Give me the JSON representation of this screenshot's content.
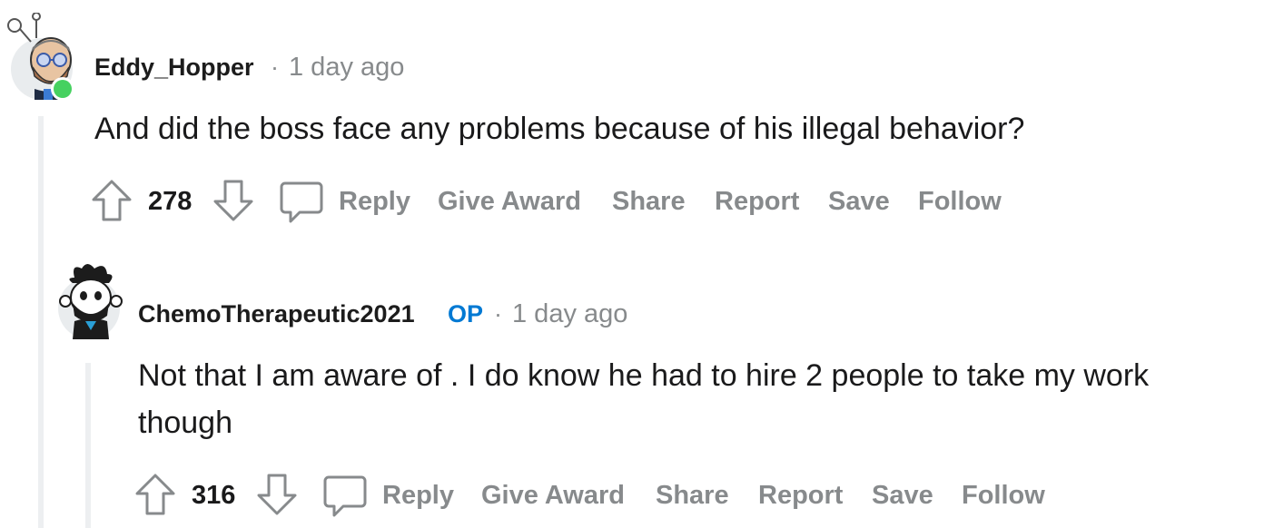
{
  "comments": [
    {
      "username": "Eddy_Hopper",
      "is_op": false,
      "separator": "·",
      "time": "1 day ago",
      "body": "And did the boss face any problems because of his illegal behavior?",
      "score": "278",
      "actions": [
        "Reply",
        "Give Award",
        "Share",
        "Report",
        "Save",
        "Follow"
      ],
      "online": true
    },
    {
      "username": "ChemoTherapeutic2021",
      "is_op": true,
      "op_label": "OP",
      "separator": "·",
      "time": "1 day ago",
      "body": "Not that I am aware of . I do know he had to hire 2 people to take my work though",
      "score": "316",
      "actions": [
        "Reply",
        "Give Award",
        "Share",
        "Report",
        "Save",
        "Follow"
      ]
    }
  ],
  "colors": {
    "text": "#1a1a1b",
    "meta": "#878a8c",
    "op": "#0079d3",
    "thread_line": "#edeff1",
    "online": "#46d160"
  },
  "icons": [
    "upvote-arrow-icon",
    "downvote-arrow-icon",
    "comment-bubble-icon"
  ]
}
